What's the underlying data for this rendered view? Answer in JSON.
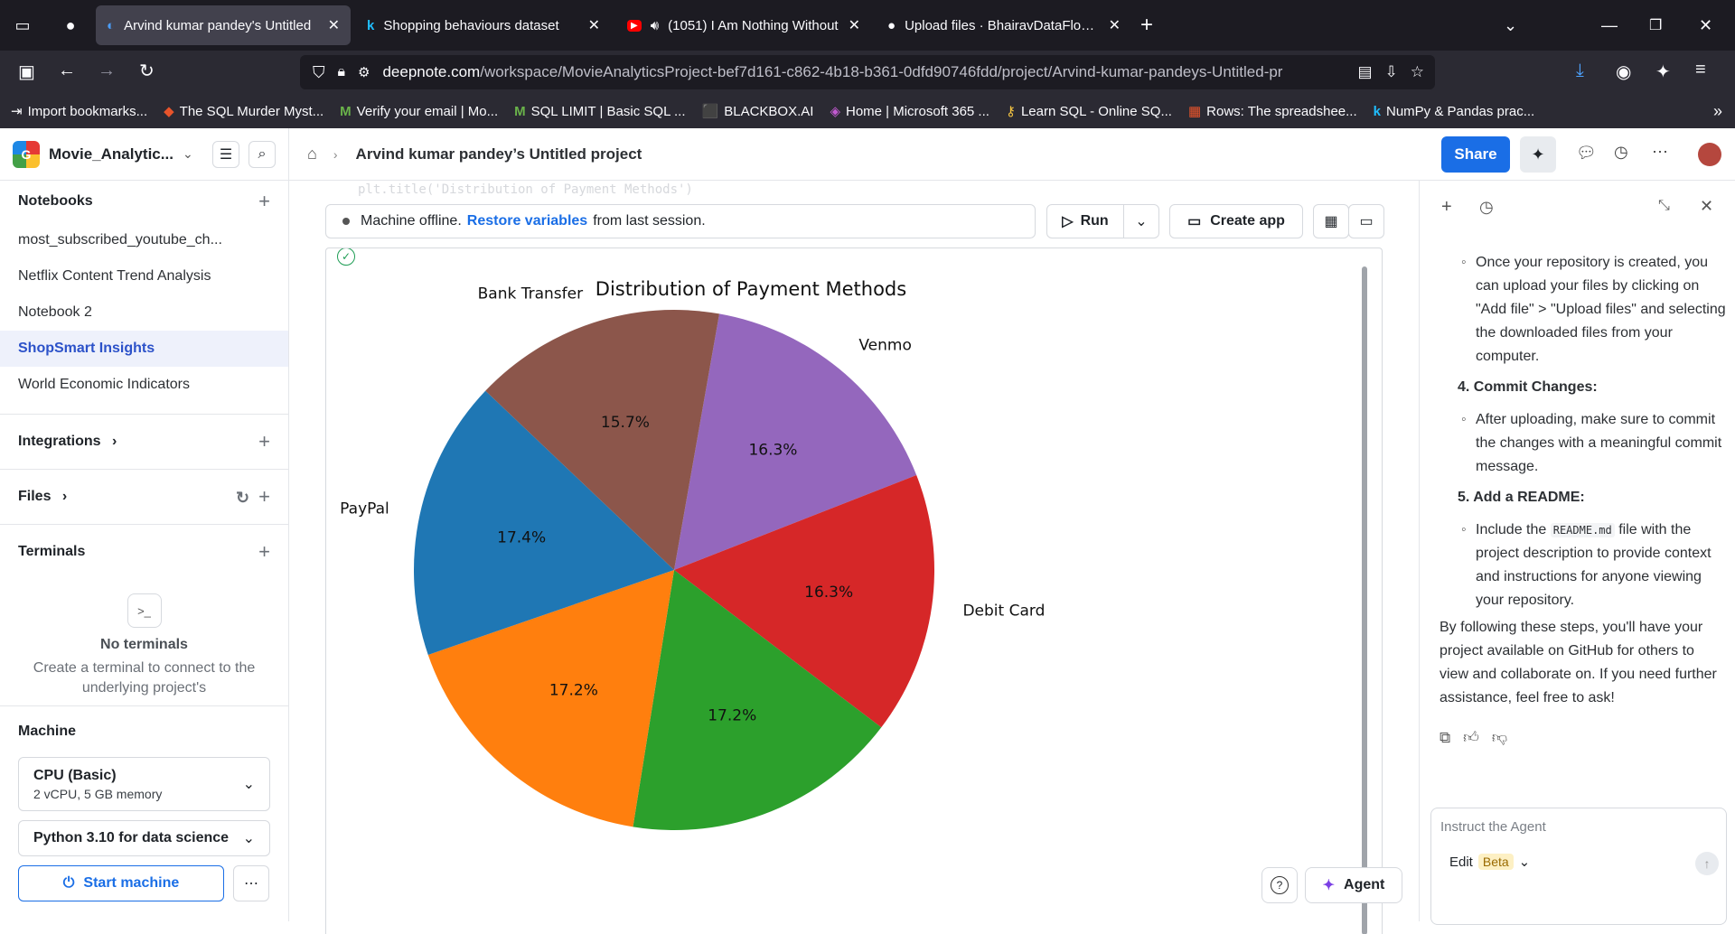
{
  "browser": {
    "tabs": [
      {
        "title": "Arvind kumar pandey's Untitled",
        "icon": "deepnote-icon",
        "active": true
      },
      {
        "title": "Shopping behaviours dataset",
        "icon": "kaggle-icon",
        "active": false
      },
      {
        "title": "(1051) I Am Nothing Without",
        "icon": "youtube-icon",
        "active": false
      },
      {
        "title": "Upload files · BhairavDataFlow/S",
        "icon": "github-icon",
        "active": false
      }
    ],
    "url_domain": "deepnote.com",
    "url_path": "/workspace/MovieAnalyticsProject-bef7d161-c862-4b18-b361-0dfd90746fdd/project/Arvind-kumar-pandeys-Untitled-pr",
    "bookmarks": [
      {
        "label": "Import bookmarks...",
        "icon": "import-icon"
      },
      {
        "label": "The SQL Murder Myst...",
        "icon": "diamond-icon"
      },
      {
        "label": "Verify your email | Mo...",
        "icon": "mongodb-icon"
      },
      {
        "label": "SQL LIMIT | Basic SQL ...",
        "icon": "mongodb-icon"
      },
      {
        "label": "BLACKBOX.AI",
        "icon": "blackbox-icon"
      },
      {
        "label": "Home | Microsoft 365 ...",
        "icon": "m365-icon"
      },
      {
        "label": "Learn SQL - Online SQ...",
        "icon": "key-icon"
      },
      {
        "label": "Rows: The spreadshee...",
        "icon": "rows-icon"
      },
      {
        "label": "NumPy & Pandas prac...",
        "icon": "kaggle-icon"
      }
    ]
  },
  "sidebar": {
    "workspace": "Movie_Analytic...",
    "notebooks_title": "Notebooks",
    "notebooks": [
      {
        "label": "most_subscribed_youtube_ch...",
        "selected": false
      },
      {
        "label": "Netflix Content Trend Analysis",
        "selected": false
      },
      {
        "label": "Notebook 2",
        "selected": false
      },
      {
        "label": "ShopSmart Insights",
        "selected": true
      },
      {
        "label": "World Economic Indicators",
        "selected": false
      }
    ],
    "integrations": "Integrations",
    "files": "Files",
    "terminals": "Terminals",
    "no_terminals": "No terminals",
    "no_terminals_desc": "Create a terminal to connect to the underlying project's",
    "machine_title": "Machine",
    "machine_name": "CPU (Basic)",
    "machine_spec": "2 vCPU, 5 GB memory",
    "python_env": "Python 3.10 for data science",
    "start_label": "Start machine"
  },
  "topbar": {
    "project_title": "Arvind kumar pandey’s Untitled project",
    "share_label": "Share"
  },
  "notebook": {
    "status_text": "Machine offline.",
    "restore_link": "Restore variables",
    "status_suffix": "from last session.",
    "run_label": "Run",
    "create_app_label": "Create app",
    "code_hint": "plt.title('Distribution of Payment Methods')",
    "help_label": "?",
    "agent_label": "Agent"
  },
  "chart_data": {
    "type": "pie",
    "title": "Distribution of Payment Methods",
    "slices": [
      {
        "label": "Venmo",
        "value": 16.3,
        "pct": "16.3%",
        "color": "#9467bd"
      },
      {
        "label": "Debit Card",
        "value": 16.3,
        "pct": "16.3%",
        "color": "#d62728"
      },
      {
        "label": "",
        "value": 17.2,
        "pct": "17.2%",
        "color": "#2ca02c"
      },
      {
        "label": "",
        "value": 17.2,
        "pct": "17.2%",
        "color": "#ff7f0e"
      },
      {
        "label": "PayPal",
        "value": 17.4,
        "pct": "17.4%",
        "color": "#1f77b4"
      },
      {
        "label": "Bank Transfer",
        "value": 15.7,
        "pct": "15.7%",
        "color": "#8c564b"
      }
    ]
  },
  "agent": {
    "lines": {
      "p1": "Once your repository is created, you can upload your files by clicking on \"Add file\" > \"Upload files\" and selecting the downloaded files from your computer.",
      "h4": "4. Commit Changes:",
      "p2": "After uploading, make sure to commit the changes with a meaningful commit message.",
      "h5": "5. Add a README:",
      "p3a": "Include the",
      "p3code": "README.md",
      "p3b": "file with the project description to provide context and instructions for anyone viewing your repository.",
      "p4": "By following these steps, you'll have your project available on GitHub for others to view and collaborate on. If you need further assistance, feel free to ask!"
    },
    "input_placeholder": "Instruct the Agent",
    "mode_label": "Edit",
    "beta_label": "Beta"
  },
  "colors": {
    "accent": "#1a6ee6",
    "selected_bg": "#eef1fb",
    "browser_bg": "#1c1b22"
  }
}
